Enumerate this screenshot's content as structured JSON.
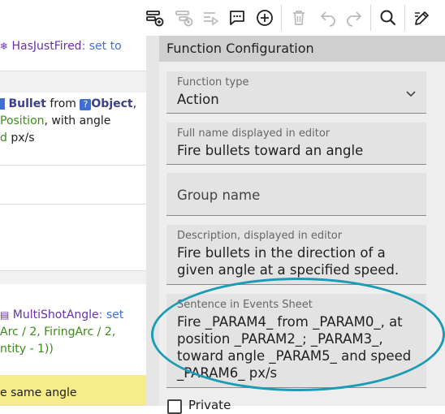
{
  "toolbar": {
    "icons": [
      "add-event-icon",
      "add-subevent-icon",
      "add-instruction-icon",
      "add-comment-icon",
      "add-icon",
      "delete-icon",
      "undo-icon",
      "redo-icon",
      "search-icon",
      "edit-icon"
    ]
  },
  "left": {
    "row1": {
      "object": "HasJustFired",
      "tail": "set to"
    },
    "row2": {
      "bullet": "Bullet",
      "from": "from",
      "object": "Object",
      "comma": ",",
      "position": "Position",
      "with_angle": ", with angle",
      "d": "d",
      "pxs": "px/s"
    },
    "row3": {
      "name": "MultiShotAngle",
      "set": "set",
      "line2": "Arc / 2, FiringArc / 2,",
      "line3": "ntity - 1))"
    },
    "row4": {
      "text": "e same angle"
    }
  },
  "panel": {
    "title": "Function Configuration",
    "function_type": {
      "label": "Function type",
      "value": "Action"
    },
    "full_name": {
      "label": "Full name displayed in editor",
      "value": "Fire bullets toward an angle"
    },
    "group_name": {
      "placeholder": "Group name"
    },
    "description": {
      "label": "Description, displayed in editor",
      "line1": "Fire bullets in the direction of a",
      "line2": "given angle at a specified speed."
    },
    "sentence": {
      "label": "Sentence in Events Sheet",
      "line1": "Fire _PARAM4_ from _PARAM0_, at",
      "line2": "position _PARAM2_; _PARAM3_,",
      "line3": "toward angle _PARAM5_ and speed",
      "line4": "_PARAM6_ px/s"
    },
    "private": {
      "label": "Private"
    }
  },
  "colors": {
    "accent": "#1a9bb6",
    "object_purple": "#6a2fa8",
    "green": "#3c8a1a",
    "blue": "#3f6fd0",
    "yellow": "#f7ec8a"
  }
}
